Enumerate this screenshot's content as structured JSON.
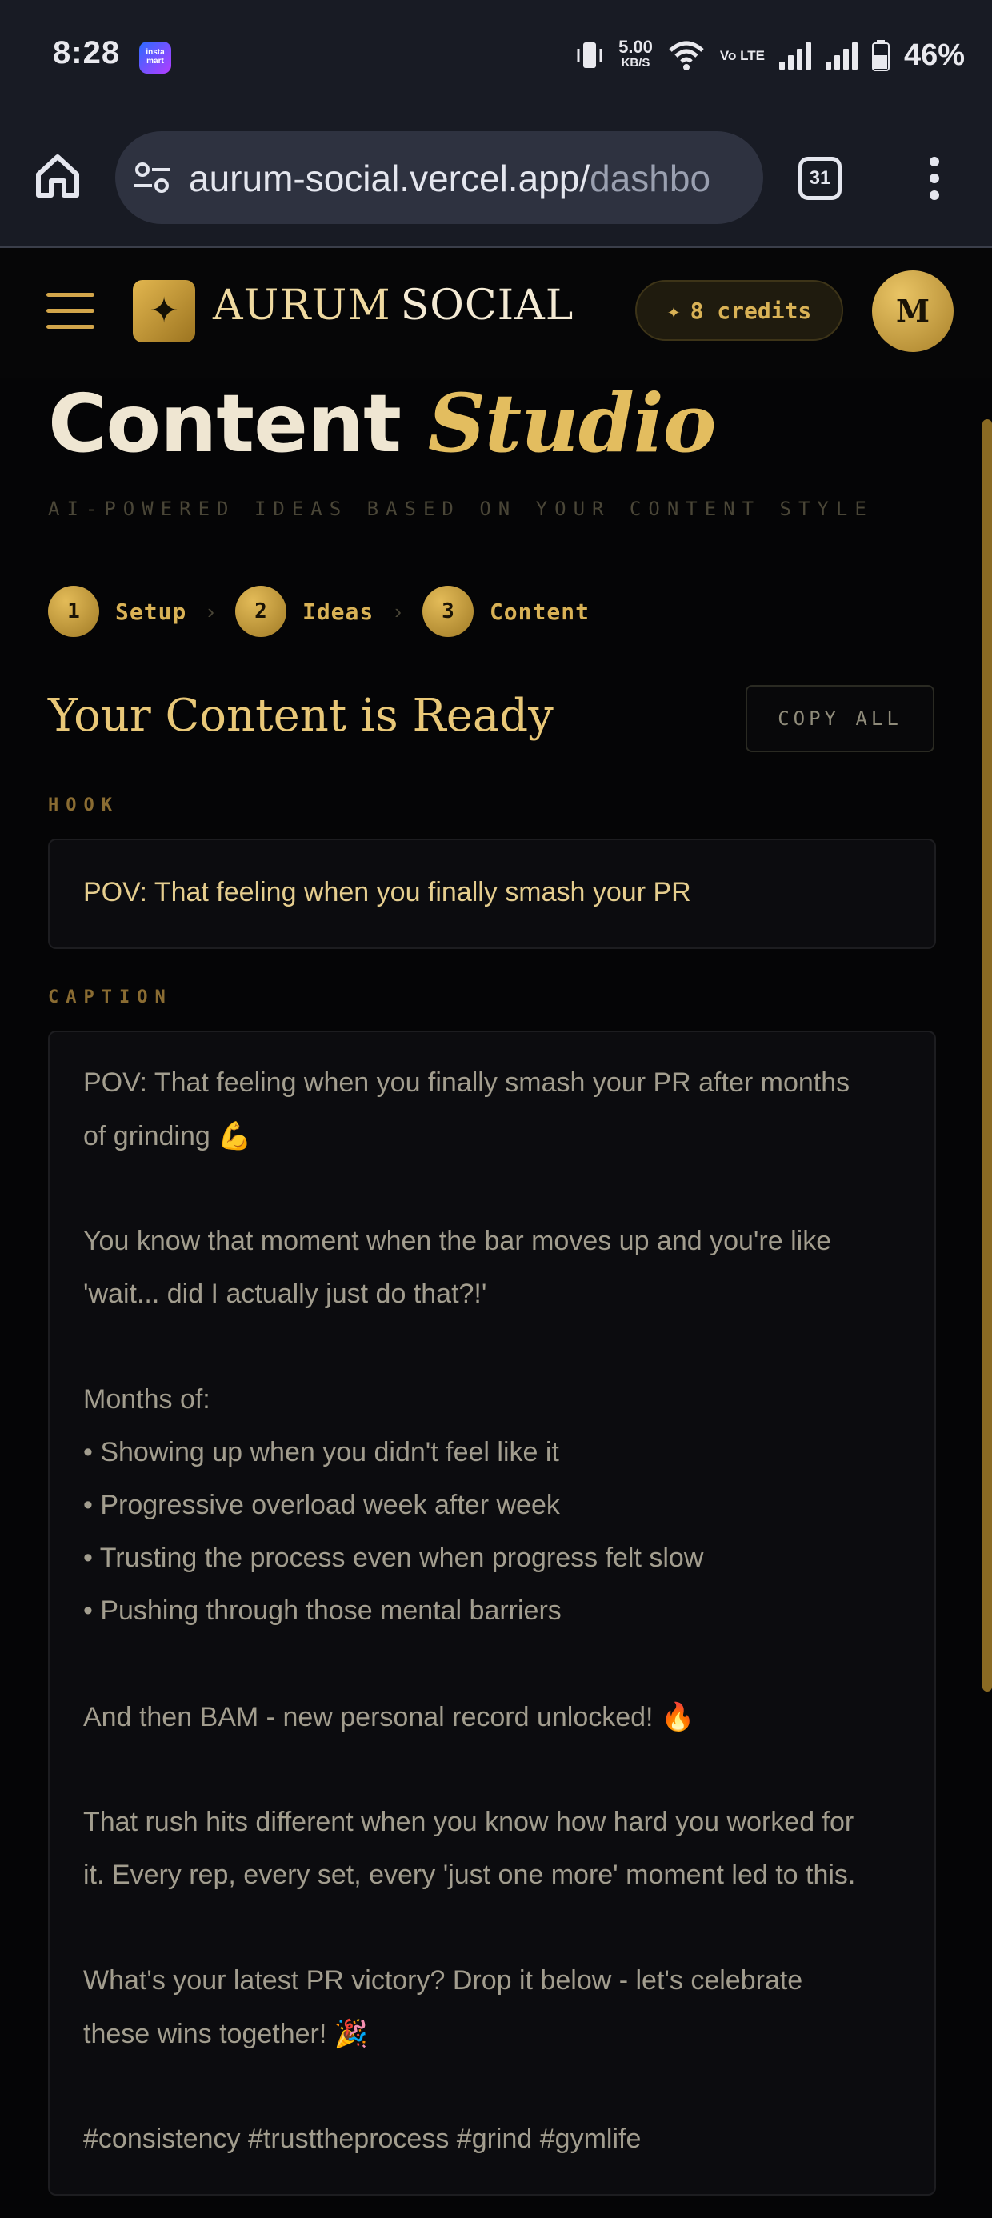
{
  "status_bar": {
    "time": "8:28",
    "app_icon_text": "insta mart",
    "net_speed": "5.00",
    "net_unit": "KB/S",
    "volte": "Vo LTE",
    "battery": "46%"
  },
  "browser": {
    "url_main": "aurum-social.vercel.app/",
    "url_faded": "dashbo",
    "tab_count": "31"
  },
  "header": {
    "brand_first": "AURUM",
    "brand_second": "SOCIAL",
    "credits_label": "8 credits",
    "avatar_initial": "M"
  },
  "page": {
    "title_plain": "Content",
    "title_accent": "Studio",
    "subtitle": "AI-POWERED IDEAS BASED ON YOUR CONTENT STYLE"
  },
  "steps": [
    {
      "num": "1",
      "label": "Setup"
    },
    {
      "num": "2",
      "label": "Ideas"
    },
    {
      "num": "3",
      "label": "Content"
    }
  ],
  "result": {
    "title": "Your Content is Ready",
    "copy_all_label": "COPY ALL",
    "hook_label": "HOOK",
    "hook_text": "POV: That feeling when you finally smash your PR",
    "caption_label": "CAPTION",
    "caption_lines": [
      "POV: That feeling when you finally smash your PR after months",
      "of grinding 💪",
      "You know that moment when the bar moves up and you're like",
      "'wait... did I actually just do that?!'",
      "Months of:",
      "• Showing up when you didn't feel like it",
      "• Progressive overload week after week",
      "• Trusting the process even when progress felt slow",
      "• Pushing through those mental barriers",
      "And then BAM - new personal record unlocked! 🔥",
      "That rush hits different when you know how hard you worked for",
      "it. Every rep, every set, every 'just one more' moment led to this.",
      "What's your latest PR victory? Drop it below - let's celebrate",
      "these wins together! 🎉",
      "#consistency #trusttheprocess #grind #gymlife"
    ]
  },
  "colors": {
    "gold": "#d9b256",
    "background": "#050506",
    "card": "#0c0c0f"
  }
}
